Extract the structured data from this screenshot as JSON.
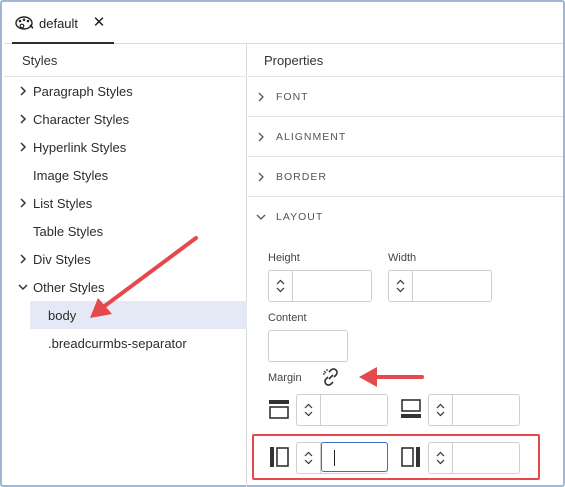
{
  "tab": {
    "label": "default",
    "close_glyph": "✕",
    "icon": "palette-icon"
  },
  "left_panel": {
    "title": "Styles",
    "items": [
      {
        "label": "Paragraph Styles",
        "expandable": true
      },
      {
        "label": "Character Styles",
        "expandable": true
      },
      {
        "label": "Hyperlink Styles",
        "expandable": true
      },
      {
        "label": "Image Styles",
        "expandable": false
      },
      {
        "label": "List Styles",
        "expandable": true
      },
      {
        "label": "Table Styles",
        "expandable": false
      },
      {
        "label": "Div Styles",
        "expandable": true
      },
      {
        "label": "Other Styles",
        "expandable": true,
        "expanded": true
      }
    ],
    "children": [
      {
        "label": "body",
        "selected": true
      },
      {
        "label": ".breadcurmbs-separator",
        "selected": false
      }
    ]
  },
  "right_panel": {
    "title": "Properties",
    "sections": [
      {
        "label": "FONT",
        "expanded": false
      },
      {
        "label": "ALIGNMENT",
        "expanded": false
      },
      {
        "label": "BORDER",
        "expanded": false
      },
      {
        "label": "LAYOUT",
        "expanded": true
      }
    ],
    "layout": {
      "height_label": "Height",
      "width_label": "Width",
      "content_label": "Content",
      "margin_label": "Margin",
      "margin_link_icon": "unlink-icon"
    }
  },
  "annotation_color": "#e5484d",
  "selection_color": "#e4e9f5",
  "accent_color": "#3b6fd1"
}
